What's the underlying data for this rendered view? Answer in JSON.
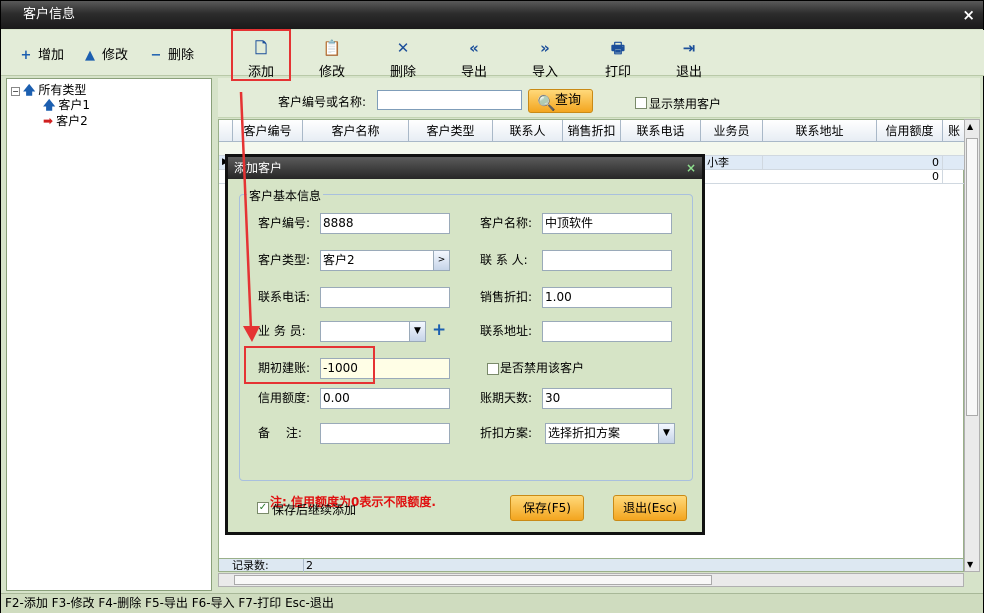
{
  "window": {
    "title": "客户信息",
    "close": "×"
  },
  "left_toolbar": {
    "add": "增加",
    "edit": "修改",
    "delete": "删除"
  },
  "toolbar": {
    "add": "添加",
    "edit": "修改",
    "delete": "删除",
    "export": "导出",
    "import": "导入",
    "print": "打印",
    "exit": "退出"
  },
  "tree": {
    "root": "所有类型",
    "items": [
      "客户1",
      "客户2"
    ]
  },
  "search": {
    "label": "客户编号或名称:",
    "value": "",
    "query_button": "查询",
    "show_disabled": "显示禁用客户"
  },
  "grid": {
    "columns": [
      "客户编号",
      "客户名称",
      "客户类型",
      "联系人",
      "销售折扣",
      "联系电话",
      "业务员",
      "联系地址",
      "信用额度",
      "账"
    ],
    "rows": [
      {
        "salesman": "小李",
        "credit": "0"
      },
      {
        "salesman": "",
        "credit": "0"
      }
    ],
    "footer_label": "记录数:",
    "footer_count": "2"
  },
  "dialog": {
    "title": "添加客户",
    "close": "×",
    "section": "客户基本信息",
    "fields": {
      "code_label": "客户编号:",
      "code_value": "8888",
      "name_label": "客户名称:",
      "name_value": "中顶软件",
      "type_label": "客户类型:",
      "type_value": "客户2",
      "contact_label": "联 系 人:",
      "contact_value": "",
      "phone_label": "联系电话:",
      "phone_value": "",
      "discount_label": "销售折扣:",
      "discount_value": "1.00",
      "salesman_label": "业 务 员:",
      "salesman_value": "",
      "address_label": "联系地址:",
      "address_value": "",
      "opening_label": "期初建账:",
      "opening_value": "-1000",
      "disable_label": "是否禁用该客户",
      "credit_label": "信用额度:",
      "credit_value": "0.00",
      "days_label": "账期天数:",
      "days_value": "30",
      "remark_label": "备　 注:",
      "remark_value": "",
      "scheme_label": "折扣方案:",
      "scheme_value": "选择折扣方案"
    },
    "note": "注: 信用额度为0表示不限额度.",
    "continue_label": "保存后继续添加",
    "save_button": "保存(F5)",
    "exit_button": "退出(Esc)"
  },
  "status_bar": "F2-添加 F3-修改 F4-删除 F5-导出 F6-导入 F7-打印 Esc-退出",
  "colors": {
    "highlight": "#e53333",
    "accent": "#f3a51f",
    "note": "#e01010"
  }
}
